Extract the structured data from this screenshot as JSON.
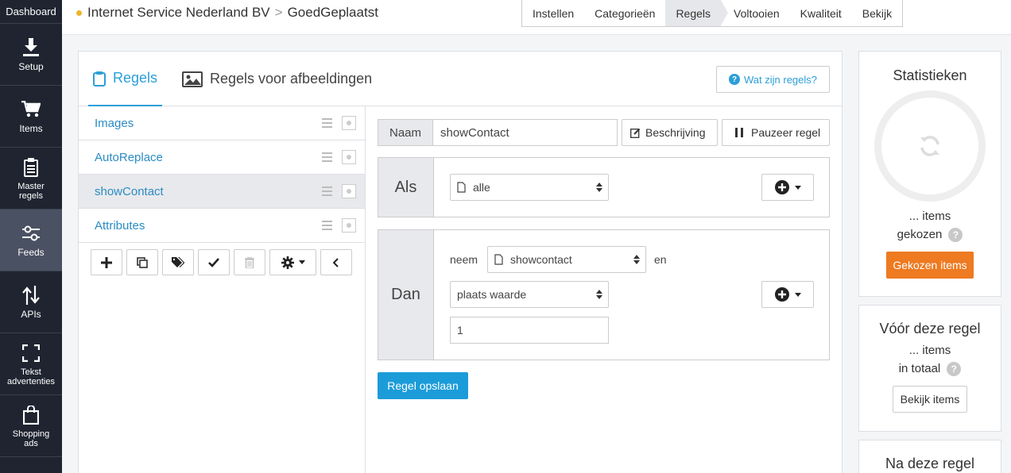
{
  "sidebar": {
    "dashboard": "Dashboard",
    "items": [
      {
        "label": "Setup",
        "icon": "download-icon"
      },
      {
        "label": "Items",
        "icon": "cart-icon"
      },
      {
        "label": "Master regels",
        "icon": "clipboard-icon"
      },
      {
        "label": "Feeds",
        "icon": "sliders-icon",
        "active": true
      },
      {
        "label": "APIs",
        "icon": "arrows-updown-icon"
      },
      {
        "label": "Tekst advertenties",
        "icon": "expand-icon"
      },
      {
        "label": "Shopping ads",
        "icon": "shopping-bag-icon"
      }
    ]
  },
  "breadcrumb": {
    "company": "Internet Service Nederland BV",
    "separator": ">",
    "project": "GoedGeplaatst"
  },
  "steps": [
    "Instellen",
    "Categorieën",
    "Regels",
    "Voltooien",
    "Kwaliteit",
    "Bekijk"
  ],
  "active_step": "Regels",
  "tabs": {
    "rules": "Regels",
    "image_rules": "Regels voor afbeeldingen",
    "help": "Wat zijn regels?"
  },
  "rules": [
    "Images",
    "AutoReplace",
    "showContact",
    "Attributes"
  ],
  "active_rule": "showContact",
  "editor": {
    "name_label": "Naam",
    "name_value": "showContact",
    "description_button": "Beschrijving",
    "pause_button": "Pauzeer regel",
    "if_label": "Als",
    "if_select": "alle",
    "then_label": "Dan",
    "take_label": "neem",
    "take_select": "showcontact",
    "and_label": "en",
    "action_select": "plaats waarde",
    "value": "1",
    "save_button": "Regel opslaan"
  },
  "stats": {
    "title": "Statistieken",
    "items_line": "... items",
    "chosen_label": "gekozen",
    "chosen_button": "Gekozen items"
  },
  "before": {
    "title": "Vóór deze regel",
    "items_line": "... items",
    "total_label": "in totaal",
    "view_button": "Bekijk items"
  },
  "after": {
    "title": "Na deze regel"
  },
  "colors": {
    "sidebar": "#1f2430",
    "accent": "#2b9fd8",
    "save": "#1b9cd8",
    "orange": "#ee7a21"
  }
}
